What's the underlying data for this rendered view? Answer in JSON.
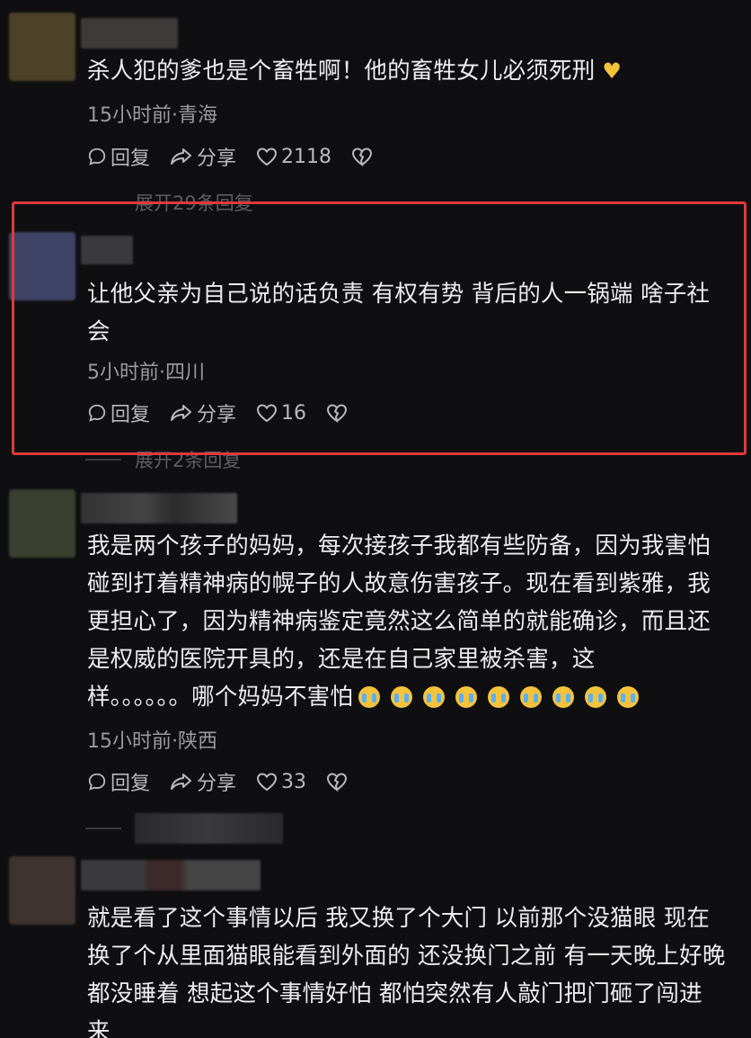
{
  "comments": [
    {
      "text": "杀人犯的爹也是个畜牲啊！他的畜牲女儿必须死刑",
      "meta": "15小时前·青海",
      "reply_label": "回复",
      "share_label": "分享",
      "likes": "2118",
      "expand": "展开29条回复"
    },
    {
      "text_line1": "让他父亲为自己说的话负责 有权有势 背后的人一锅端  啥子社",
      "text_line2": "会",
      "meta": "5小时前·四川",
      "reply_label": "回复",
      "share_label": "分享",
      "likes": "16",
      "expand": "展开2条回复"
    },
    {
      "text_line1": "我是两个孩子的妈妈，每次接孩子我都有些防备，因为我害怕",
      "text_line2": "碰到打着精神病的幌子的人故意伤害孩子。现在看到紫雅，我",
      "text_line3": "更担心了，因为精神病鉴定竟然这么简单的就能确诊，而且还",
      "text_line4": "是权威的医院开具的，还是在自己家里被杀害，这",
      "text_line5": "样。。。。。。哪个妈妈不害怕",
      "meta": "15小时前·陕西",
      "reply_label": "回复",
      "share_label": "分享",
      "likes": "33"
    },
    {
      "text_line1": "就是看了这个事情以后 我又换了个大门 以前那个没猫眼 现在",
      "text_line2": "换了个从里面猫眼能看到外面的 还没换门之前 有一天晚上好晚",
      "text_line3": "都没睡着 想起这个事情好怕 都怕突然有人敲门把门砸了闯进",
      "text_line4": "来"
    }
  ],
  "icons": {
    "reply": "comment-bubble-icon",
    "share": "share-arrow-icon",
    "like": "heart-outline-icon",
    "dislike": "broken-heart-icon",
    "emoji_crying": "crying-face-emoji",
    "emoji_heart": "yellow-heart-emoji"
  },
  "colors": {
    "background": "#0f0f12",
    "text": "#ececef",
    "meta": "#9a9aa2",
    "highlight_border": "#e0393b"
  }
}
